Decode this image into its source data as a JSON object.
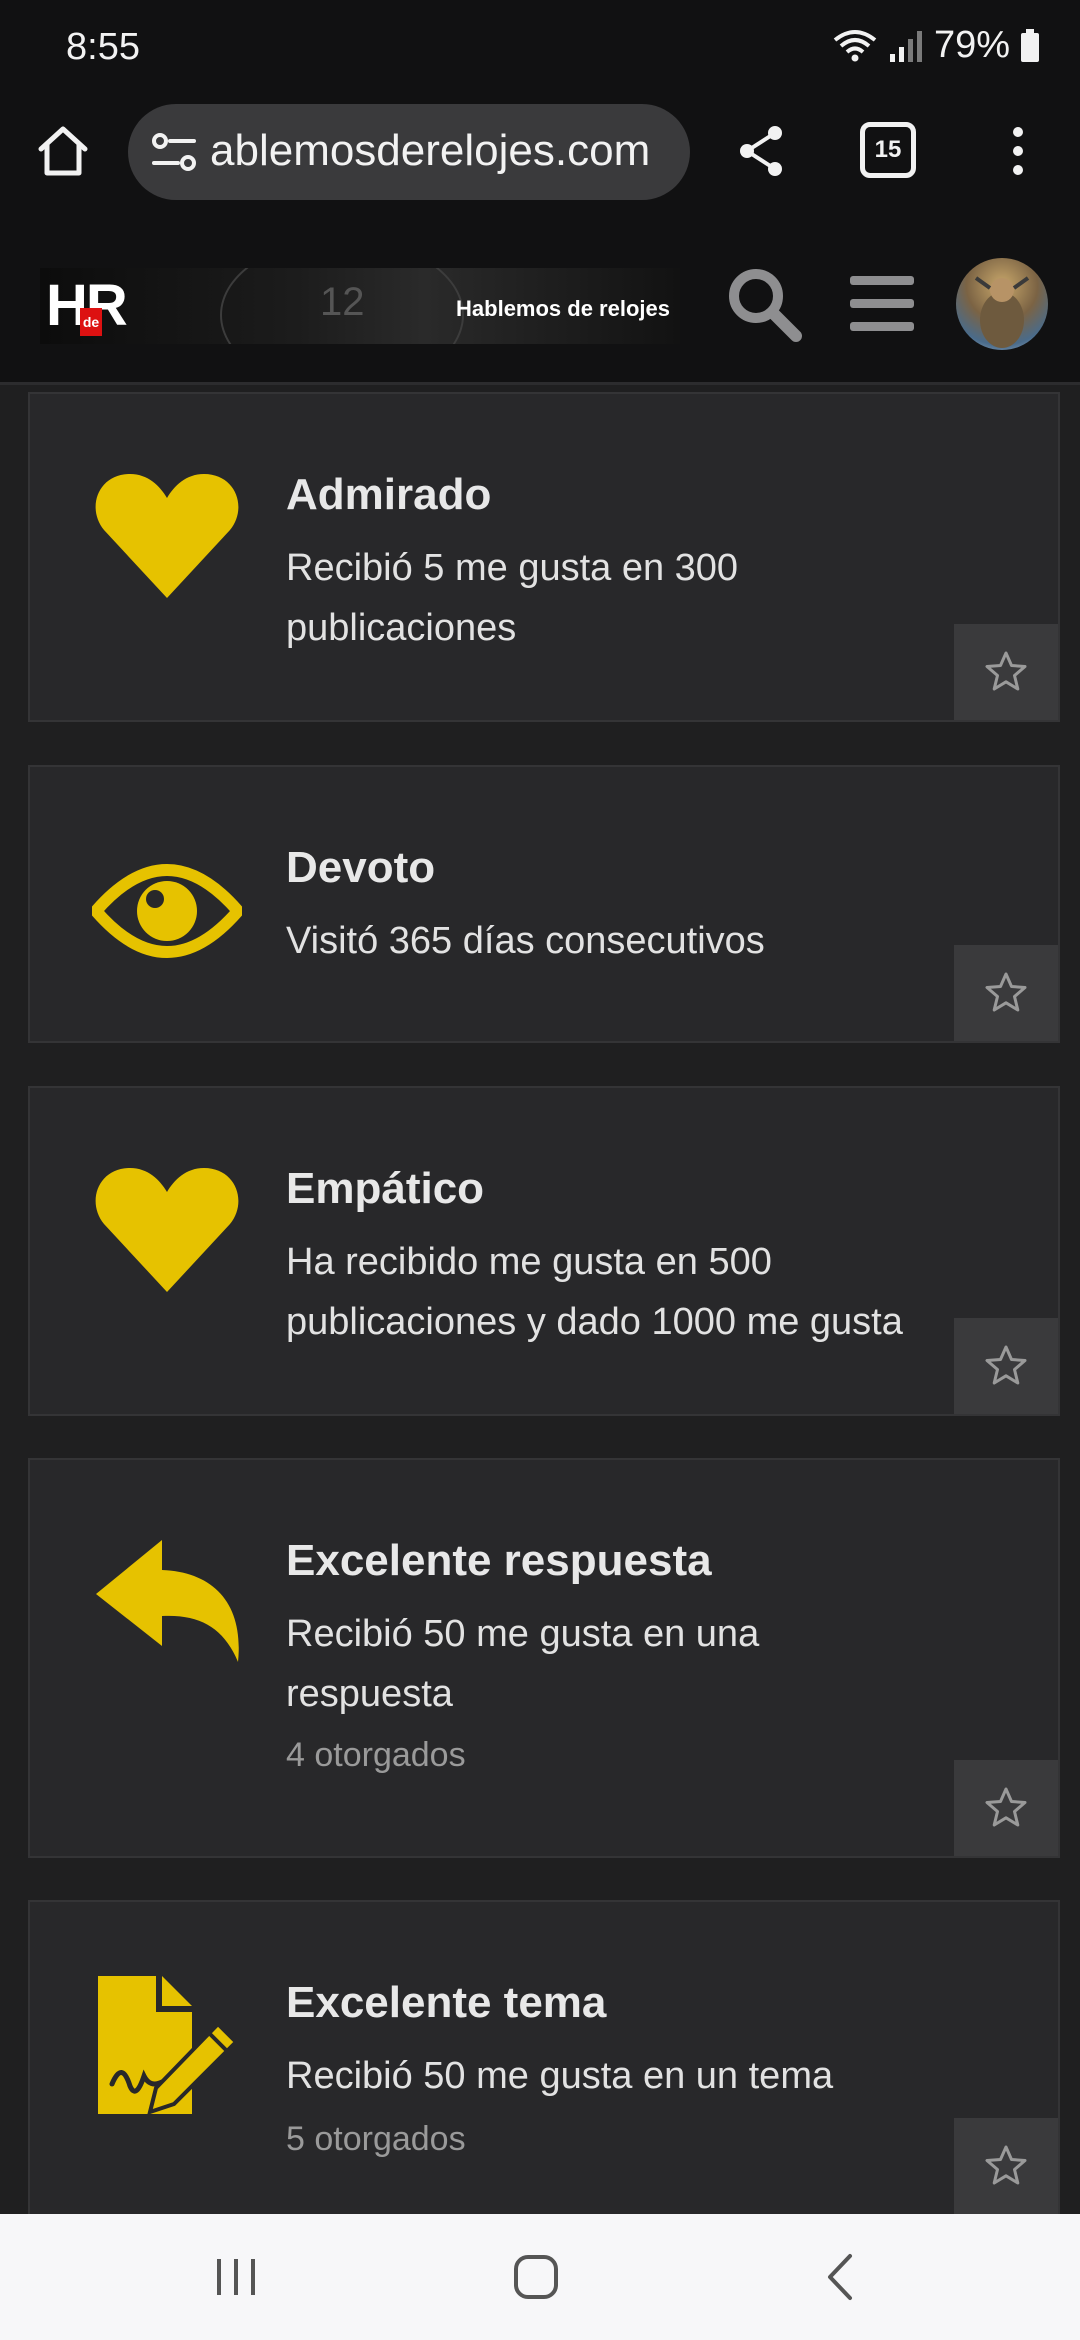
{
  "status_bar": {
    "time": "8:55",
    "battery": "79%"
  },
  "browser": {
    "url": "ablemosderelojes.com",
    "tab_count": "15"
  },
  "site": {
    "logo_letters": "HR",
    "logo_de": "de",
    "logo_dial": "12",
    "logo_name": "Hablemos de relojes"
  },
  "colors": {
    "accent": "#e6c200",
    "card_bg": "#28282a",
    "page_bg": "#1f1f20"
  },
  "badges": [
    {
      "icon": "heart-icon",
      "title": "Admirado",
      "desc_line1": "Recibió 5 me gusta en 300",
      "desc_line2": "publicaciones",
      "count": ""
    },
    {
      "icon": "eye-icon",
      "title": "Devoto",
      "desc_line1": "Visitó 365 días consecutivos",
      "desc_line2": "",
      "count": ""
    },
    {
      "icon": "heart-icon",
      "title": "Empático",
      "desc_line1": "Ha recibido me gusta en 500",
      "desc_line2": "publicaciones y dado 1000 me gusta",
      "count": ""
    },
    {
      "icon": "reply-icon",
      "title": "Excelente respuesta",
      "desc_line1": "Recibió 50 me gusta en una",
      "desc_line2": "respuesta",
      "count": "4 otorgados"
    },
    {
      "icon": "file-signature-icon",
      "title": "Excelente tema",
      "desc_line1": "Recibió 50 me gusta en un tema",
      "desc_line2": "",
      "count": "5 otorgados"
    }
  ]
}
